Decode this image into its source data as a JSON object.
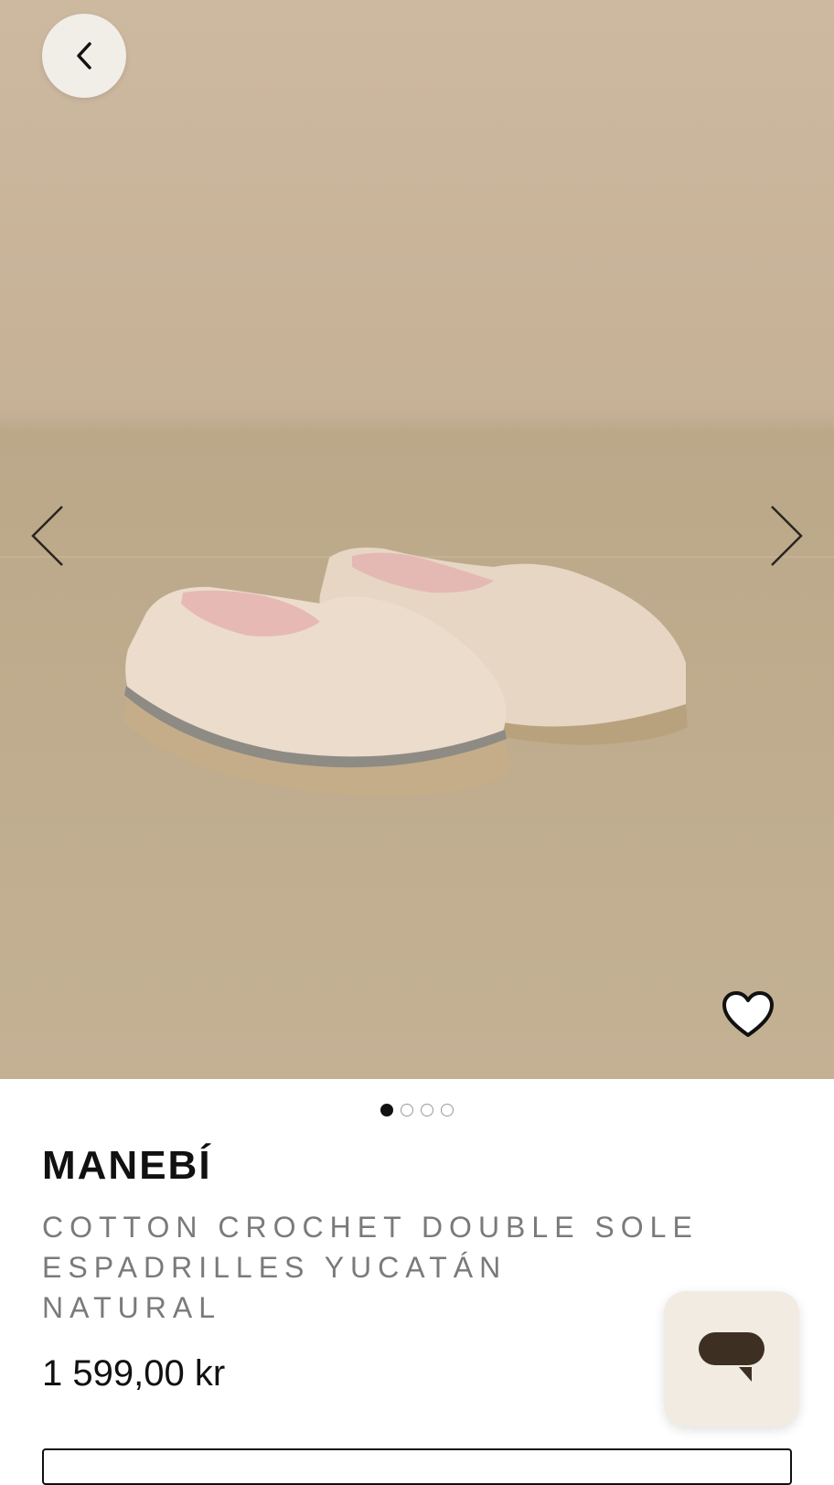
{
  "product": {
    "brand": "MANEBÍ",
    "name_line1": "COTTON CROCHET DOUBLE SOLE",
    "name_line2": "ESPADRILLES YUCATÁN NATURAL",
    "price": "1 599,00 kr"
  },
  "gallery": {
    "image_count": 4,
    "active_index": 0,
    "image_alt_icon": "product-photo"
  },
  "icons": {
    "back": "chevron-left-icon",
    "prev": "chevron-left-icon",
    "next": "chevron-right-icon",
    "favorite": "heart-icon",
    "chat": "chat-bubble-icon"
  },
  "colors": {
    "accent_dark": "#111111",
    "chat_bg": "#f1ebe2",
    "chat_icon": "#3d3023",
    "hero_bg": "#c6b196"
  }
}
